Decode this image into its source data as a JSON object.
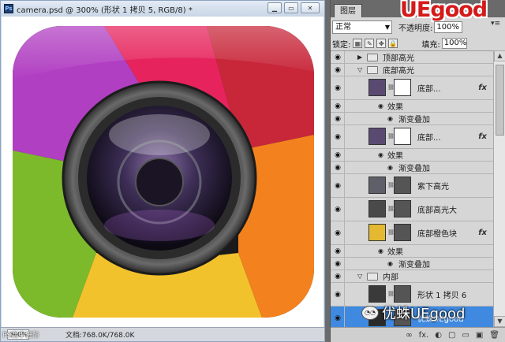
{
  "document": {
    "app_logo": "Ps",
    "title": "camera.psd @ 300% (形状 1 拷贝 5, RGB/8) *",
    "minimize": "▁",
    "restore": "▭",
    "close": "✕",
    "zoom": "300%",
    "info": "文档:768.0K/768.0K"
  },
  "icon": {
    "colors": [
      "#e6235c",
      "#c42a6d",
      "#a53bb5",
      "#7bb52a",
      "#f1c32b",
      "#f58a1e",
      "#e63a2e"
    ]
  },
  "layers_panel": {
    "tab": "图层",
    "brand": "UEgood",
    "menu": "▾≡",
    "blend_mode": "正常",
    "opacity_label": "不透明度:",
    "opacity": "100%",
    "lock_label": "锁定:",
    "fill_label": "填充:",
    "fill": "100%",
    "layers": [
      {
        "type": "group",
        "name": "顶部高光",
        "expanded": false
      },
      {
        "type": "group",
        "name": "底部高光",
        "expanded": true
      },
      {
        "type": "layer",
        "name": "底部...",
        "fx": "fx",
        "thumb": "#5a4a72",
        "mask": "#ffffff"
      },
      {
        "type": "effects",
        "name": "效果"
      },
      {
        "type": "effect",
        "name": "渐变叠加"
      },
      {
        "type": "layer",
        "name": "底部...",
        "fx": "fx",
        "thumb": "#5a4a72",
        "mask": "#ffffff"
      },
      {
        "type": "effects",
        "name": "效果"
      },
      {
        "type": "effect",
        "name": "渐变叠加"
      },
      {
        "type": "layer",
        "name": "紫下高光",
        "fx": "",
        "thumb": "#5f5f6a",
        "mask": "#555"
      },
      {
        "type": "layer",
        "name": "底部高光大",
        "fx": "",
        "thumb": "#4a4a4a",
        "mask": "#555"
      },
      {
        "type": "layer",
        "name": "底部橙色块",
        "fx": "fx",
        "thumb": "#e4b830",
        "mask": "#555"
      },
      {
        "type": "effects",
        "name": "效果"
      },
      {
        "type": "effect",
        "name": "渐变叠加"
      },
      {
        "type": "group",
        "name": "内部",
        "expanded": true
      },
      {
        "type": "layer",
        "name": "形状 1 拷贝 6",
        "fx": "",
        "thumb": "#3a3a3a",
        "mask": "#555"
      },
      {
        "type": "layer",
        "name": "优蛛UEgood",
        "fx": "",
        "thumb": "#2a2a2a",
        "mask": "#555",
        "selected": true
      }
    ],
    "bottom_icons": [
      "∞",
      "fx.",
      "◐",
      "▢",
      "▭",
      "▣",
      "🗑"
    ]
  },
  "watermark": {
    "text": "优蛛UEgood",
    "left_text": "PS高手进阶",
    "wechat": "◔◔"
  }
}
